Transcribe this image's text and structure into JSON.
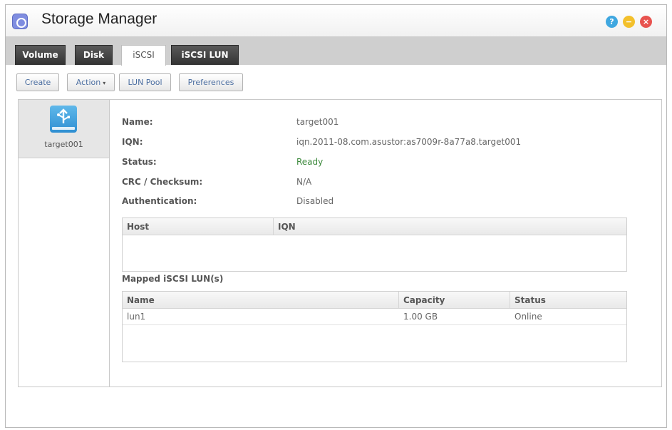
{
  "window": {
    "title": "Storage Manager"
  },
  "title_buttons": {
    "help": "?",
    "minimize": "−",
    "close": "×"
  },
  "tabs": [
    {
      "label": "Volume",
      "active": false
    },
    {
      "label": "Disk",
      "active": false
    },
    {
      "label": "iSCSI",
      "active": true
    },
    {
      "label": "iSCSI LUN",
      "active": false
    }
  ],
  "toolbar": {
    "create": "Create",
    "action": "Action",
    "action_caret": "▾",
    "lun_pool": "LUN Pool",
    "preferences": "Preferences"
  },
  "sidebar": {
    "items": [
      {
        "label": "target001",
        "selected": true
      }
    ]
  },
  "details": {
    "name_label": "Name:",
    "name_value": "target001",
    "iqn_label": "IQN:",
    "iqn_value": "iqn.2011-08.com.asustor:as7009r-8a77a8.target001",
    "status_label": "Status:",
    "status_value": "Ready",
    "crc_label": "CRC / Checksum:",
    "crc_value": "N/A",
    "auth_label": "Authentication:",
    "auth_value": "Disabled"
  },
  "host_table": {
    "headers": [
      "Host",
      "IQN"
    ],
    "rows": []
  },
  "mapped": {
    "title": "Mapped iSCSI LUN(s)",
    "headers": [
      "Name",
      "Capacity",
      "Status"
    ],
    "rows": [
      {
        "name": "lun1",
        "capacity": "1.00 GB",
        "status": "Online"
      }
    ]
  },
  "colors": {
    "tab_dark": "#333333",
    "link_text": "#4a6da0",
    "status_ready": "#3d8a3d",
    "icon_blue": "#2f8fd2"
  }
}
